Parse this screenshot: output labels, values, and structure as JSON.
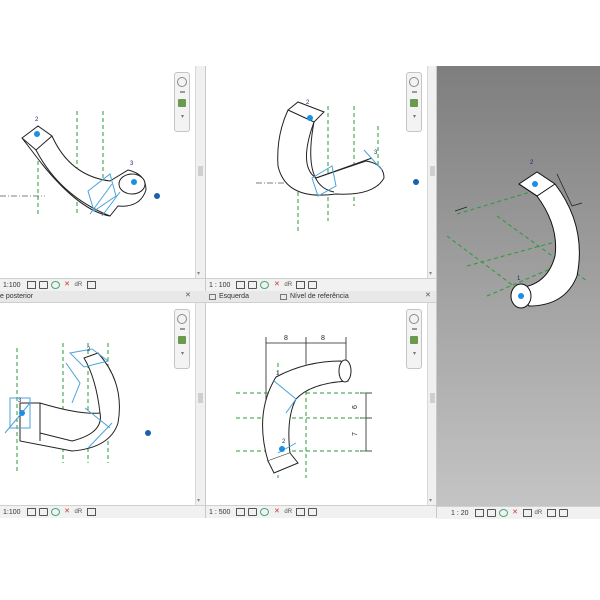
{
  "views": {
    "top_left": {
      "scale": "1:100",
      "labels": [
        "2",
        "3"
      ]
    },
    "top_mid": {
      "scale": "1 : 100",
      "labels": [
        "2",
        "3"
      ]
    },
    "right_3d": {
      "scale": "1 : 20",
      "labels": [
        "2",
        "1"
      ]
    },
    "bottom_left": {
      "scale": "1:100",
      "labels": [
        "2",
        "3"
      ]
    },
    "bottom_mid": {
      "scale": "1 : 500",
      "labels": [
        "1",
        "2"
      ],
      "dimensions": {
        "top_left": "8",
        "top_right": "8",
        "right_upper": "6",
        "right_lower": "7"
      }
    }
  },
  "tabs": {
    "left": "e posterior",
    "mid": "Esquerda",
    "right": "Nível de referência"
  },
  "status_icons": [
    "model-graphics",
    "visual-style",
    "sun-path",
    "shadows",
    "render",
    "crop-region",
    "temporary-hide",
    "reveal-hidden",
    "analysis"
  ],
  "colors": {
    "accent_blue": "#1b8fe6",
    "grid_green": "#2a9a3a",
    "curve_blue": "#4aa3d8",
    "dark_bg": "#8c8c8c"
  }
}
